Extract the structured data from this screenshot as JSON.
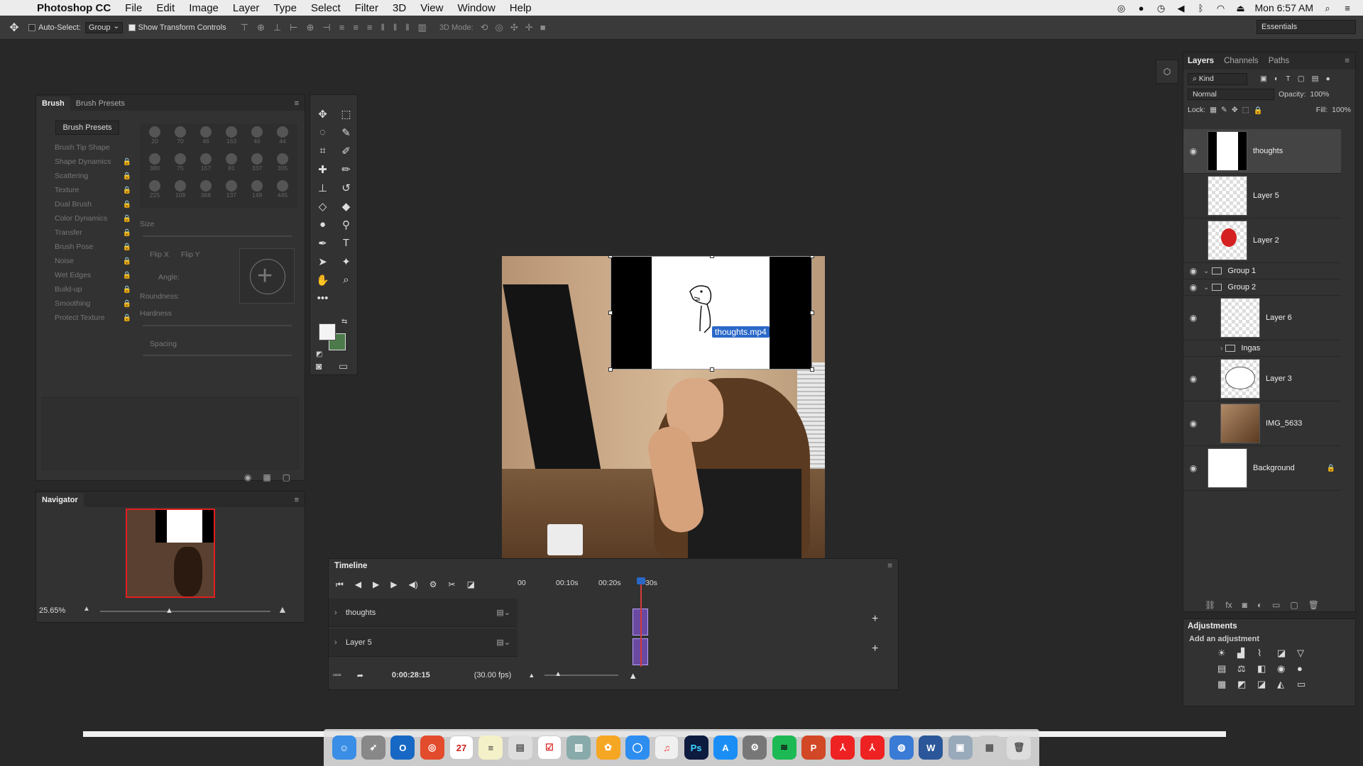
{
  "menubar": {
    "app_name": "Photoshop CC",
    "menus": [
      "File",
      "Edit",
      "Image",
      "Layer",
      "Type",
      "Select",
      "Filter",
      "3D",
      "View",
      "Window",
      "Help"
    ],
    "clock": "Mon 6:57 AM"
  },
  "options_bar": {
    "auto_select_label": "Auto-Select:",
    "auto_select_target": "Group",
    "show_transform_label": "Show Transform Controls",
    "mode_3d_label": "3D Mode:",
    "workspace": "Essentials"
  },
  "brush_panel": {
    "tabs": [
      "Brush",
      "Brush Presets"
    ],
    "presets_button": "Brush Presets",
    "options": [
      "Brush Tip Shape",
      "Shape Dynamics",
      "Scattering",
      "Texture",
      "Dual Brush",
      "Color Dynamics",
      "Transfer",
      "Brush Pose",
      "Noise",
      "Wet Edges",
      "Build-up",
      "Smoothing",
      "Protect Texture"
    ],
    "tip_sizes": [
      "20",
      "70",
      "46",
      "163",
      "46",
      "44",
      "380",
      "75",
      "157",
      "81",
      "337",
      "305",
      "225",
      "108",
      "368",
      "137",
      "149",
      "445"
    ],
    "size_label": "Size",
    "flip_x": "Flip X",
    "flip_y": "Flip Y",
    "angle_label": "Angle:",
    "roundness_label": "Roundness:",
    "hardness_label": "Hardness",
    "spacing_label": "Spacing"
  },
  "navigator": {
    "title": "Navigator",
    "zoom": "25.65%"
  },
  "canvas": {
    "clip_label": "thoughts.mp4"
  },
  "timeline": {
    "title": "Timeline",
    "ruler": [
      "00",
      "00:10s",
      "00:20s",
      "30s"
    ],
    "tracks": [
      {
        "name": "thoughts"
      },
      {
        "name": "Layer 5"
      }
    ],
    "timecode": "0:00:28:15",
    "fps": "(30.00 fps)"
  },
  "layers_panel": {
    "tabs": [
      "Layers",
      "Channels",
      "Paths"
    ],
    "filter": "Kind",
    "blend_mode": "Normal",
    "opacity_label": "Opacity:",
    "opacity": "100%",
    "lock_label": "Lock:",
    "fill_label": "Fill:",
    "fill": "100%",
    "layers": [
      {
        "name": "thoughts",
        "visible": true,
        "selected": true
      },
      {
        "name": "Layer 5",
        "visible": false
      },
      {
        "name": "Layer 2",
        "visible": false
      },
      {
        "name": "Group 1",
        "visible": true,
        "group": true
      },
      {
        "name": "Group 2",
        "visible": true,
        "group": true
      },
      {
        "name": "Layer 6",
        "visible": true
      },
      {
        "name": "Ingas",
        "visible": false,
        "group": true
      },
      {
        "name": "Layer 3",
        "visible": true
      },
      {
        "name": "IMG_5633",
        "visible": true
      },
      {
        "name": "Background",
        "visible": true
      }
    ]
  },
  "adjustments": {
    "title": "Adjustments",
    "add_label": "Add an adjustment"
  },
  "dock": {
    "calendar_day": "27"
  },
  "colors": {
    "accent": "#2a68c8",
    "playhead": "#d43a3a",
    "clip": "#6a4aa0",
    "background_swatch": "#4c7a4a"
  }
}
